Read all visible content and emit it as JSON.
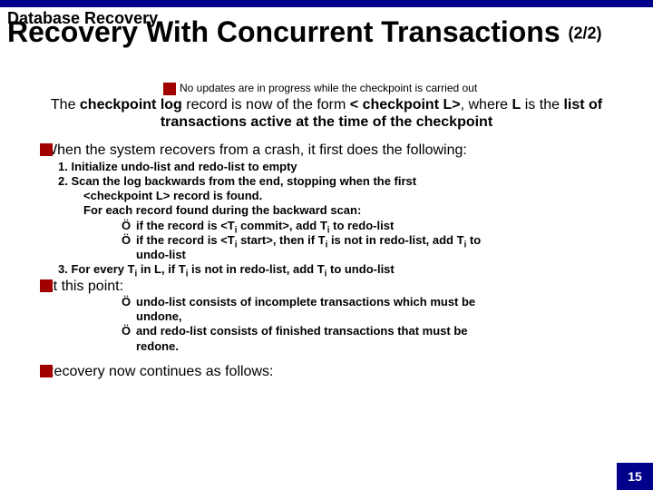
{
  "header": {
    "section": "Database Recovery"
  },
  "title": {
    "main": "Recovery With Concurrent Transactions",
    "suffix": "(2/2)"
  },
  "note": "No updates are in progress while the checkpoint is carried out",
  "para1_a": "The ",
  "para1_b": "checkpoint log",
  "para1_c": " record is now of the form ",
  "para1_d": "< checkpoint L>",
  "para1_e": ", where ",
  "para1_f": "L",
  "para1_g": " is the ",
  "para1_h": "list of transactions",
  "para1_i": " active at the time of the checkpoint",
  "para2": "When the system recovers from a crash, it first does the following:",
  "step1_a": "1. Initialize  undo-list and  redo-list to empty",
  "step2_a": "2. Scan the log backwards from the end, stopping when the first",
  "step2_b": "<checkpoint L> record is found.",
  "step2_c": "For each record found during the backward scan:",
  "step2_d1": "if the record is <T",
  "step2_d2": " commit>, add T",
  "step2_d3": " to redo-list",
  "step2_e1": "if the record is <T",
  "step2_e2": "  start>, then if T",
  "step2_e3": " is not in  redo-list, add T",
  "step2_e4": " to",
  "step2_e5": "undo-list",
  "step3_a": "3. For every T",
  "step3_b": " in L, if T",
  "step3_c": " is not in  redo-list, add T",
  "step3_d": " to undo-list",
  "atpoint": "At this point:",
  "ap1_a": "undo-list consists of incomplete transactions which must be",
  "ap1_b": "undone,",
  "ap2_a": "and redo-list consists of finished transactions that must be",
  "ap2_b": "redone.",
  "para3": "Recovery now continues as follows:",
  "page": "15",
  "arrow": "Ö"
}
